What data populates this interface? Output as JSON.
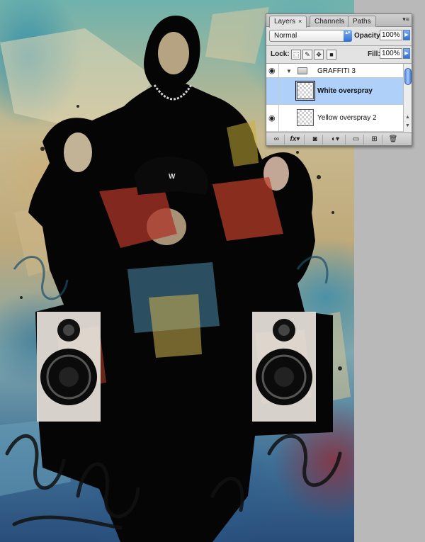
{
  "panel": {
    "tabs": [
      {
        "label": "Layers",
        "close": "×",
        "active": true
      },
      {
        "label": "Channels",
        "active": false
      },
      {
        "label": "Paths",
        "active": false
      }
    ],
    "menu_icon": "▾≡",
    "blend_mode": "Normal",
    "blend_arrows": "▴▾",
    "opacity_label": "Opacity:",
    "opacity_value": "100%",
    "lock_label": "Lock:",
    "lock_icons": [
      "transparency-lock-icon",
      "brush-lock-icon",
      "move-lock-icon",
      "padlock-icon"
    ],
    "lock_glyphs": [
      "⬚",
      "✎",
      "✥",
      "■"
    ],
    "fill_label": "Fill:",
    "fill_value": "100%",
    "arrow_glyph": "▶",
    "eye_glyph": "◉",
    "layers": [
      {
        "name": "GRAFFITI 3",
        "type": "group",
        "visible": true,
        "expanded": true,
        "expand_glyph": "▼"
      },
      {
        "name": "White overspray",
        "type": "layer",
        "visible": false,
        "selected": true
      },
      {
        "name": "Yellow overspray 2",
        "type": "layer",
        "visible": true,
        "selected": false
      }
    ],
    "scroll_up": "▲",
    "scroll_down": "▼",
    "bottom_tools": [
      {
        "icon": "link-layers-icon",
        "glyph": "∞"
      },
      {
        "icon": "fx-icon",
        "glyph": "fx▾"
      },
      {
        "icon": "layer-mask-icon",
        "glyph": "◙"
      },
      {
        "icon": "adjustment-layer-icon",
        "glyph": "◐▾"
      },
      {
        "icon": "new-group-icon",
        "glyph": "▭"
      },
      {
        "icon": "new-layer-icon",
        "glyph": "⊞"
      },
      {
        "icon": "trash-icon",
        "glyph": "🗑"
      }
    ]
  },
  "colors": {
    "panel_bg": "#e3e3e3",
    "selected_row": "#aed0f9",
    "accent_blue": "#2f6fd6",
    "workspace_bg": "#b9b9b9"
  }
}
